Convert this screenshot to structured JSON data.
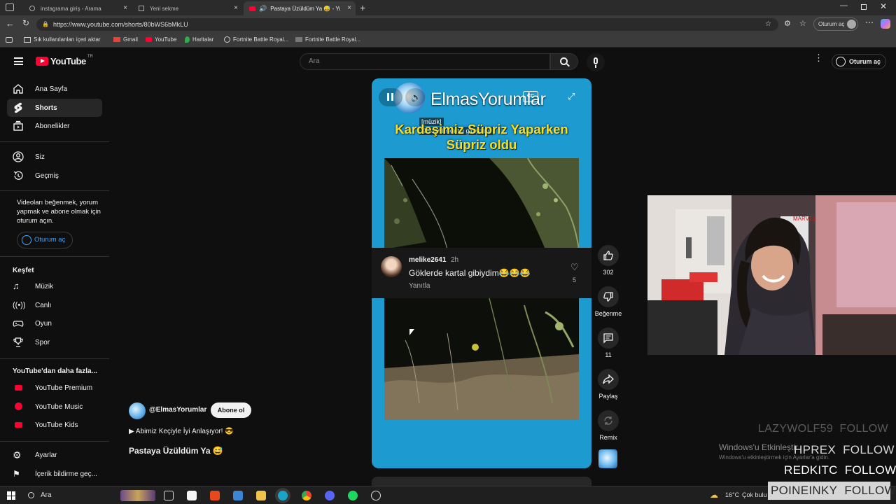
{
  "browser": {
    "tabs": [
      {
        "title": "instagrama giriş - Arama"
      },
      {
        "title": "Yeni sekme"
      },
      {
        "title": "Pastaya Üzüldüm Ya 😅 - Yo"
      }
    ],
    "url": "https://www.youtube.com/shorts/80bWS6bMkLU",
    "signin": "Oturum aç",
    "bookmarks": [
      "Sık kullanılanları içeri aktar",
      "Gmail",
      "YouTube",
      "Haritalar",
      "Fortnite Battle Royal...",
      "Fortnite Battle Royal..."
    ]
  },
  "youtube": {
    "logo": "YouTube",
    "logo_region": "TR",
    "search_placeholder": "Ara",
    "signin": "Oturum aç",
    "sidebar": {
      "main": [
        "Ana Sayfa",
        "Shorts",
        "Abonelikler"
      ],
      "you": [
        "Siz",
        "Geçmiş"
      ],
      "signin_prompt": "Videoları beğenmek, yorum yapmak ve abone olmak için oturum açın.",
      "signin_button": "Oturum aç",
      "explore_title": "Keşfet",
      "explore": [
        "Müzik",
        "Canlı",
        "Oyun",
        "Spor"
      ],
      "more_title": "YouTube'dan daha fazla...",
      "more": [
        "YouTube Premium",
        "YouTube Music",
        "YouTube Kids"
      ],
      "settings": [
        "Ayarlar",
        "İçerik bildirme geç..."
      ]
    },
    "video": {
      "overlay_channel": "ElmasYorumlar",
      "caption_tag": "[müzik]",
      "caption_text": "Göklerde kartal gibiydim.",
      "title_overlay_line1": "Kardeşimiz Süpriz Yaparken",
      "title_overlay_line2": "Süpriz oldu",
      "comment": {
        "user": "melike2641",
        "time": "2h",
        "text": "Göklerde kartal gibiydim😂😂😂",
        "reply": "Yanıtla",
        "likes": "5"
      }
    },
    "actions": {
      "likes": "302",
      "dislike": "Beğenme",
      "comments": "11",
      "share": "Paylaş",
      "remix": "Remix"
    },
    "channel": {
      "handle": "@ElmasYorumlar",
      "subscribe": "Abone ol",
      "description": "▶ Abimiz Keçiyle İyi Anlaşıyor! 😎",
      "title": "Pastaya Üzüldüm Ya 😅"
    }
  },
  "overlay": {
    "activation_title": "Windows'u Etkinleştir",
    "activation_sub": "Windows'u etkinleştirmek için Ayarlar'a gidin.",
    "follows": [
      {
        "name": "LAZYWOLF59",
        "action": "FOLLOW"
      },
      {
        "name": "HPREX",
        "action": "FOLLOW"
      },
      {
        "name": "REDKITC",
        "action": "FOLLOW"
      },
      {
        "name": "POINEINKY",
        "action": "FOLLOW"
      }
    ]
  },
  "taskbar": {
    "search": "Ara",
    "weather": "16°C",
    "weather_desc": "Çok bulu"
  },
  "colors": {
    "youtube_red": "#ff0033",
    "video_bg": "#1d9ad0",
    "title_yellow": "#f5e11a"
  }
}
